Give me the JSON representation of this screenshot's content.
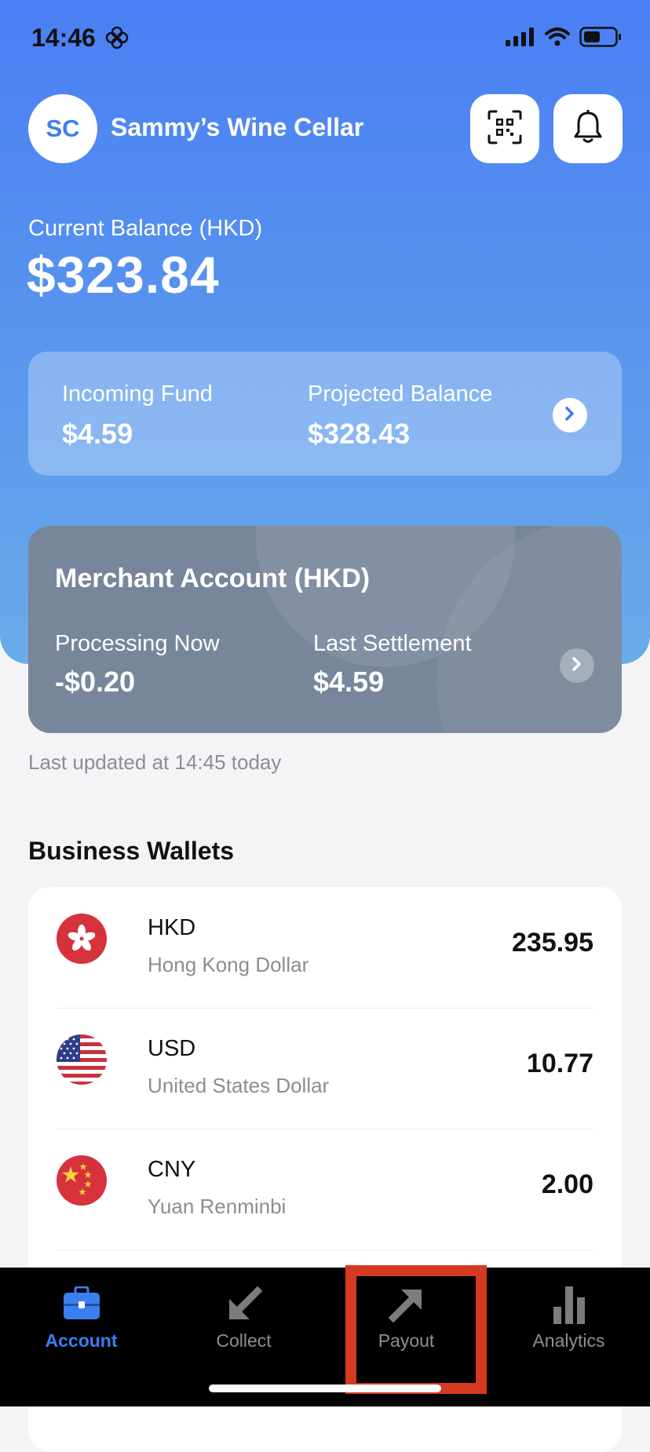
{
  "status_bar": {
    "time": "14:46",
    "icons": [
      "flower-icon",
      "signal-icon",
      "wifi-icon",
      "battery-icon"
    ]
  },
  "header": {
    "avatar_initials": "SC",
    "merchant_name": "Sammy’s Wine Cellar",
    "qr_button_icon": "qr-code-icon",
    "bell_button_icon": "bell-icon"
  },
  "balance": {
    "label": "Current Balance (HKD)",
    "amount": "$323.84"
  },
  "fund_card": {
    "incoming_label": "Incoming Fund",
    "incoming_value": "$4.59",
    "projected_label": "Projected Balance",
    "projected_value": "$328.43"
  },
  "merchant_account": {
    "title": "Merchant Account (HKD)",
    "processing_label": "Processing Now",
    "processing_value": "-$0.20",
    "settlement_label": "Last Settlement",
    "settlement_value": "$4.59"
  },
  "last_updated": "Last updated at 14:45 today",
  "wallets": {
    "title": "Business Wallets",
    "items": [
      {
        "code": "HKD",
        "name": "Hong Kong Dollar",
        "amount": "235.95",
        "flag": "hk-flag-icon"
      },
      {
        "code": "USD",
        "name": "United States Dollar",
        "amount": "10.77",
        "flag": "us-flag-icon"
      },
      {
        "code": "CNY",
        "name": "Yuan Renminbi",
        "amount": "2.00",
        "flag": "cn-flag-icon"
      }
    ]
  },
  "tabbar": {
    "items": [
      {
        "label": "Account",
        "icon": "briefcase-icon",
        "active": true
      },
      {
        "label": "Collect",
        "icon": "arrow-down-left-icon",
        "active": false
      },
      {
        "label": "Payout",
        "icon": "arrow-up-right-icon",
        "active": false
      },
      {
        "label": "Analytics",
        "icon": "bar-chart-icon",
        "active": false
      }
    ]
  },
  "colors": {
    "accent": "#3b7ef2",
    "hero_top": "#4a7ff5",
    "hero_bottom": "#69acea",
    "merchant_card": "#77869a",
    "highlight": "#d53a22"
  }
}
